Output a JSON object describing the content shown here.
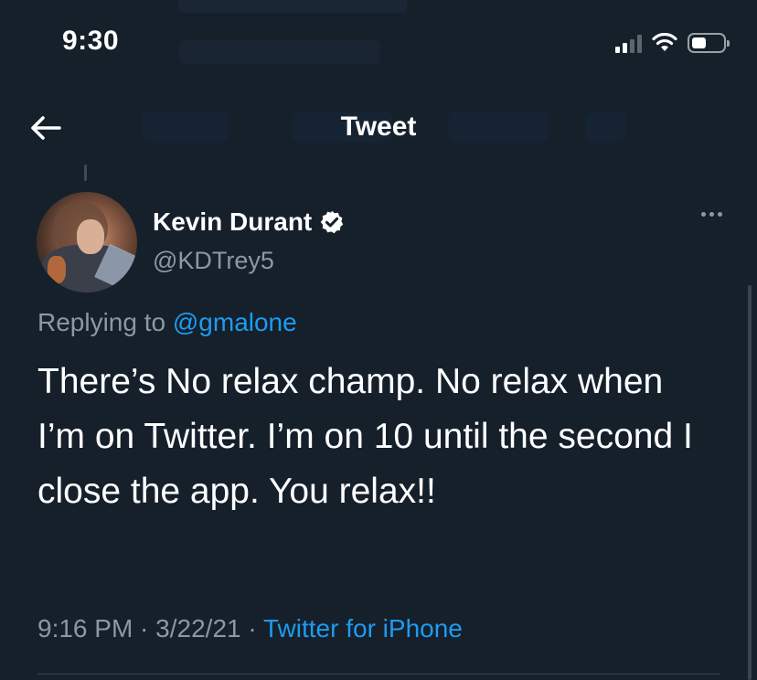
{
  "status_bar": {
    "time": "9:30",
    "icons": [
      "cellular-signal-icon",
      "wifi-icon",
      "battery-icon"
    ]
  },
  "header": {
    "back_icon": "arrow-left-icon",
    "title": "Tweet"
  },
  "tweet": {
    "author": {
      "name": "Kevin Durant",
      "handle": "@KDTrey5",
      "verified_icon": "verified-badge-icon",
      "avatar_icon": "profile-avatar"
    },
    "more_icon": "more-horizontal-icon",
    "reply": {
      "prefix": "Replying to ",
      "mention": "@gmalone"
    },
    "text": "There’s No relax champ. No relax when I’m on Twitter. I’m on 10 until the second I close the app. You relax!!",
    "meta": {
      "time": "9:16 PM",
      "sep1": " · ",
      "date": "3/22/21",
      "sep2": " · ",
      "source": "Twitter for iPhone"
    }
  },
  "colors": {
    "background": "#15202b",
    "text_primary": "#ffffff",
    "text_secondary": "#8b98a5",
    "link": "#1d9bf0",
    "divider": "#38444d"
  }
}
